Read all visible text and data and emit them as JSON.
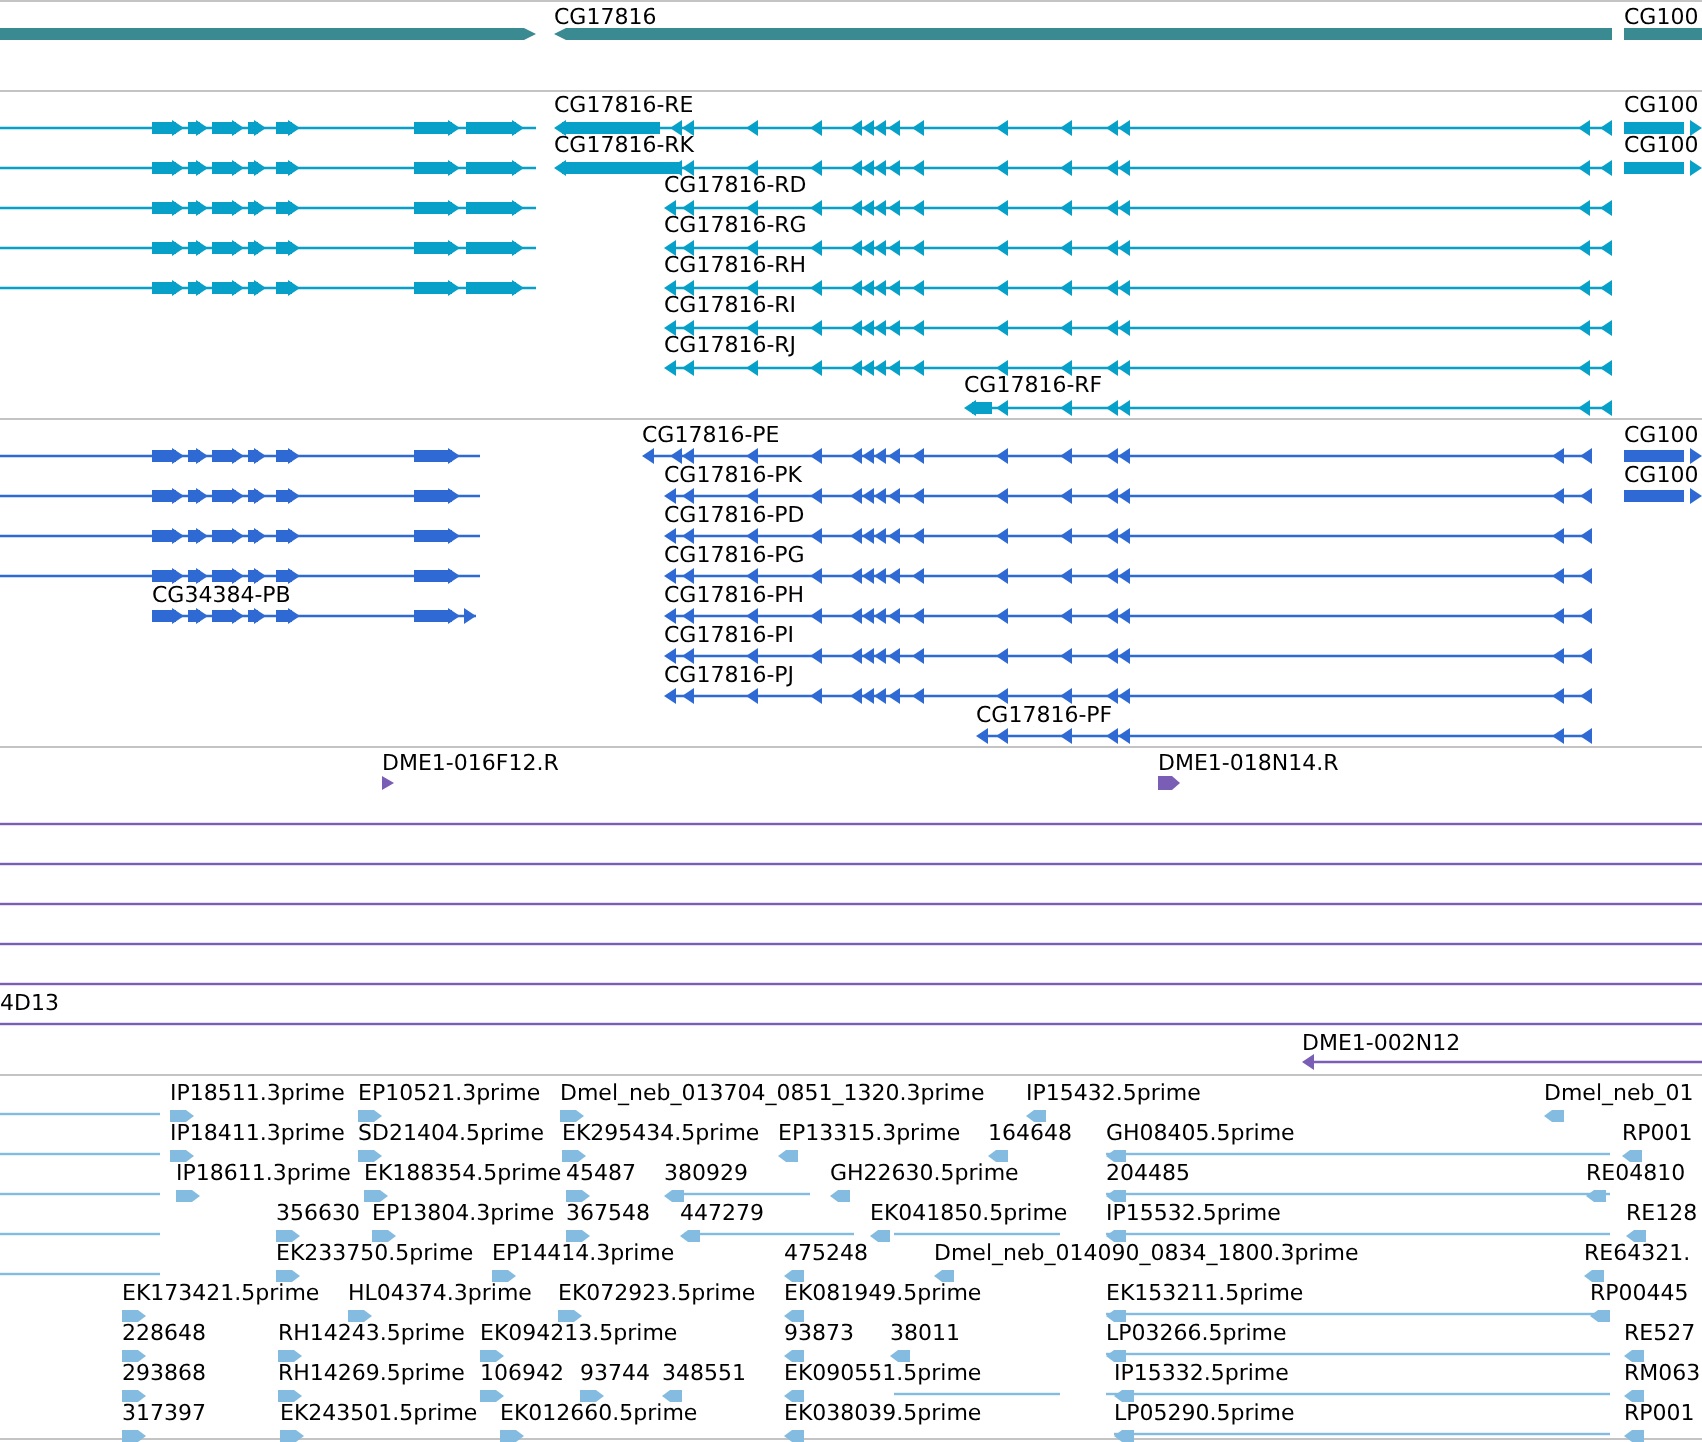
{
  "tracks": [
    {
      "kind": "gene",
      "color": "#3a8a92",
      "features": [
        {
          "label": "CG17816"
        },
        {
          "label": "CG100"
        }
      ]
    },
    {
      "kind": "transcript",
      "color": "#06a0c8",
      "features": [
        {
          "label": "CG17816-RE"
        },
        {
          "label": "CG17816-RK"
        },
        {
          "label": "CG17816-RD"
        },
        {
          "label": "CG17816-RG"
        },
        {
          "label": "CG17816-RH"
        },
        {
          "label": "CG17816-RI"
        },
        {
          "label": "CG17816-RJ"
        },
        {
          "label": "CG17816-RF"
        },
        {
          "label": "CG100"
        },
        {
          "label": "CG100"
        }
      ]
    },
    {
      "kind": "protein",
      "color": "#2f6ad4",
      "features": [
        {
          "label": "CG17816-PE"
        },
        {
          "label": "CG17816-PK"
        },
        {
          "label": "CG17816-PD"
        },
        {
          "label": "CG17816-PG"
        },
        {
          "label": "CG17816-PH"
        },
        {
          "label": "CG17816-PI"
        },
        {
          "label": "CG17816-PJ"
        },
        {
          "label": "CG17816-PF"
        },
        {
          "label": "CG34384-PB"
        },
        {
          "label": "CG100"
        },
        {
          "label": "CG100"
        }
      ]
    },
    {
      "kind": "clone",
      "color": "#7a5db5",
      "features": [
        {
          "label": "DME1-016F12.R"
        },
        {
          "label": "DME1-018N14.R"
        },
        {
          "label": "4D13"
        },
        {
          "label": "DME1-002N12"
        }
      ]
    },
    {
      "kind": "est",
      "color": "#84bbe0",
      "features": [
        {
          "label": "IP18511.3prime"
        },
        {
          "label": "EP10521.3prime"
        },
        {
          "label": "Dmel_neb_013704_0851_1320.3prime"
        },
        {
          "label": "IP15432.5prime"
        },
        {
          "label": "Dmel_neb_01"
        },
        {
          "label": "IP18411.3prime"
        },
        {
          "label": "SD21404.5prime"
        },
        {
          "label": "EK295434.5prime"
        },
        {
          "label": "EP13315.3prime"
        },
        {
          "label": "164648"
        },
        {
          "label": "GH08405.5prime"
        },
        {
          "label": "RP001"
        },
        {
          "label": "IP18611.3prime"
        },
        {
          "label": "EK188354.5prime"
        },
        {
          "label": "45487"
        },
        {
          "label": "380929"
        },
        {
          "label": "GH22630.5prime"
        },
        {
          "label": "204485"
        },
        {
          "label": "RE04810"
        },
        {
          "label": "356630"
        },
        {
          "label": "EP13804.3prime"
        },
        {
          "label": "367548"
        },
        {
          "label": "447279"
        },
        {
          "label": "EK041850.5prime"
        },
        {
          "label": "IP15532.5prime"
        },
        {
          "label": "RE128"
        },
        {
          "label": "EK233750.5prime"
        },
        {
          "label": "EP14414.3prime"
        },
        {
          "label": "475248"
        },
        {
          "label": "Dmel_neb_014090_0834_1800.3prime"
        },
        {
          "label": "RE64321."
        },
        {
          "label": "EK173421.5prime"
        },
        {
          "label": "HL04374.3prime"
        },
        {
          "label": "EK072923.5prime"
        },
        {
          "label": "EK081949.5prime"
        },
        {
          "label": "EK153211.5prime"
        },
        {
          "label": "RP00445"
        },
        {
          "label": "228648"
        },
        {
          "label": "RH14243.5prime"
        },
        {
          "label": "EK094213.5prime"
        },
        {
          "label": "93873"
        },
        {
          "label": "38011"
        },
        {
          "label": "LP03266.5prime"
        },
        {
          "label": "RE527"
        },
        {
          "label": "293868"
        },
        {
          "label": "RH14269.5prime"
        },
        {
          "label": "106942"
        },
        {
          "label": "93744"
        },
        {
          "label": "348551"
        },
        {
          "label": "EK090551.5prime"
        },
        {
          "label": "IP15332.5prime"
        },
        {
          "label": "RM063"
        },
        {
          "label": "317397"
        },
        {
          "label": "EK243501.5prime"
        },
        {
          "label": "EK012660.5prime"
        },
        {
          "label": "EK038039.5prime"
        },
        {
          "label": "LP05290.5prime"
        },
        {
          "label": "RP001"
        }
      ]
    }
  ]
}
